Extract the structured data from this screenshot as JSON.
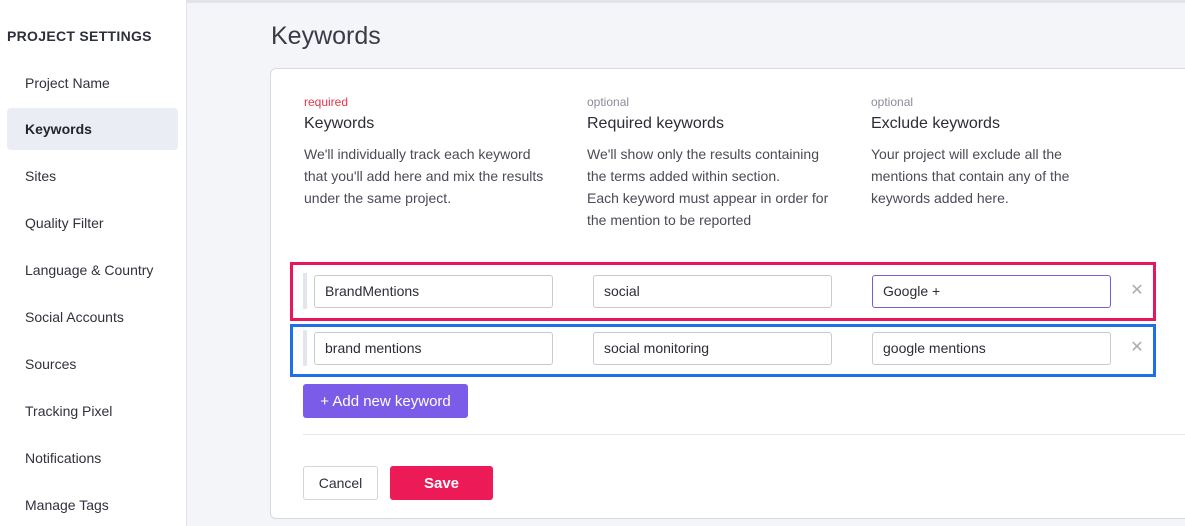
{
  "sidebar": {
    "title": "PROJECT SETTINGS",
    "items": [
      {
        "label": "Project Name"
      },
      {
        "label": "Keywords"
      },
      {
        "label": "Sites"
      },
      {
        "label": "Quality Filter"
      },
      {
        "label": "Language & Country"
      },
      {
        "label": "Social Accounts"
      },
      {
        "label": "Sources"
      },
      {
        "label": "Tracking Pixel"
      },
      {
        "label": "Notifications"
      },
      {
        "label": "Manage Tags"
      }
    ],
    "active_item": "Keywords"
  },
  "main": {
    "title": "Keywords",
    "columns": [
      {
        "tag": "required",
        "heading": "Keywords",
        "description": [
          "We'll individually track each keyword",
          "that you'll add here and mix the results",
          "under the same project."
        ]
      },
      {
        "tag": "optional",
        "heading": "Required keywords",
        "description": [
          "We'll show only the results containing",
          "the terms added within section.",
          "Each keyword must appear in order for",
          "the mention to be reported"
        ]
      },
      {
        "tag": "optional",
        "heading": "Exclude keywords",
        "description": [
          "Your project will exclude all the",
          "mentions that contain any of the",
          "keywords added here."
        ]
      }
    ],
    "rows": [
      {
        "keyword": "BrandMentions",
        "required": "social",
        "exclude": "Google +",
        "remove_icon": "close-x"
      },
      {
        "keyword": "brand mentions",
        "required": "social monitoring",
        "exclude": "google mentions",
        "remove_icon": "close-x"
      }
    ],
    "add_button_label": "+ Add new keyword",
    "cancel_label": "Cancel",
    "save_label": "Save"
  },
  "colors": {
    "accent_purple": "#7a5ce8",
    "save_red": "#ec1a57",
    "highlight_pink": "#e8175d",
    "highlight_blue": "#1f6feb"
  }
}
